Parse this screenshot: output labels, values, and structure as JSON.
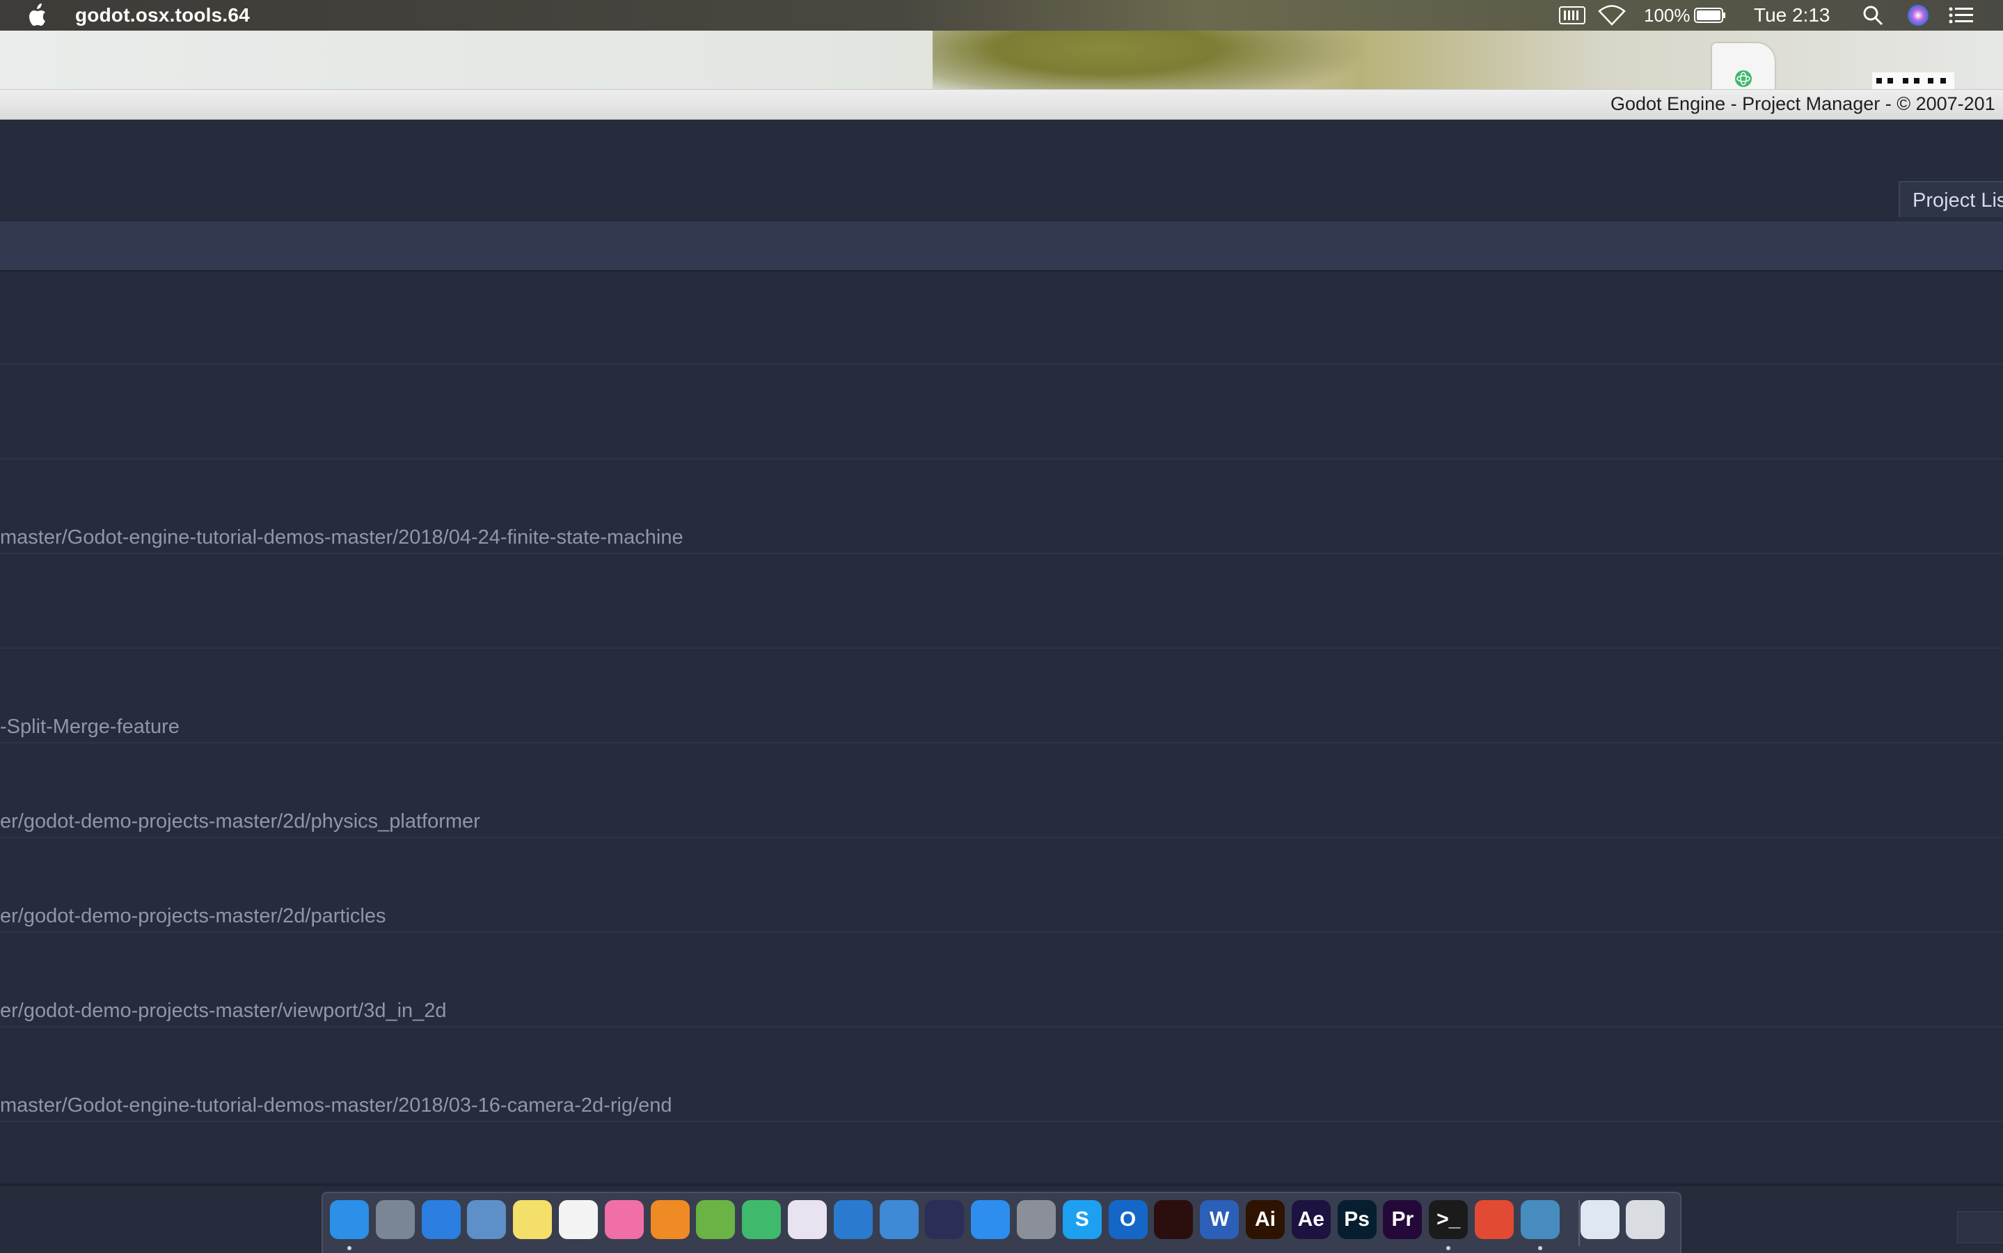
{
  "menubar": {
    "app_name": "godot.osx.tools.64",
    "battery_percent": "100%",
    "clock": "Tue 2:13",
    "icons": [
      "apple-icon",
      "keyboard-input-icon",
      "wifi-icon",
      "battery-icon",
      "spotlight-search-icon",
      "siri-icon",
      "notification-center-icon"
    ]
  },
  "window": {
    "title": "Godot Engine - Project Manager - © 2007-201"
  },
  "tabs": {
    "project_list": "Project Lis"
  },
  "projects": [
    {
      "path": ""
    },
    {
      "path": ""
    },
    {
      "path": "master/Godot-engine-tutorial-demos-master/2018/04-24-finite-state-machine"
    },
    {
      "path": ""
    },
    {
      "path": "-Split-Merge-feature"
    },
    {
      "path": "er/godot-demo-projects-master/2d/physics_platformer"
    },
    {
      "path": "er/godot-demo-projects-master/2d/particles"
    },
    {
      "path": "er/godot-demo-projects-master/viewport/3d_in_2d"
    },
    {
      "path": "master/Godot-engine-tutorial-demos-master/2018/03-16-camera-2d-rig/end"
    }
  ],
  "dock": {
    "items": [
      {
        "name": "finder",
        "label": "",
        "color": "#2c8fe8",
        "running": true
      },
      {
        "name": "launchpad",
        "label": "",
        "color": "#7a8596",
        "running": false
      },
      {
        "name": "safari",
        "label": "",
        "color": "#2a7fe0",
        "running": false
      },
      {
        "name": "preview",
        "label": "",
        "color": "#5d8fc8",
        "running": false
      },
      {
        "name": "notes",
        "label": "",
        "color": "#f3df6a",
        "running": false
      },
      {
        "name": "photos",
        "label": "",
        "color": "#f3f3f3",
        "running": false
      },
      {
        "name": "itunes",
        "label": "",
        "color": "#f06fa6",
        "running": false
      },
      {
        "name": "blender",
        "label": "",
        "color": "#f08a24",
        "running": false
      },
      {
        "name": "android-studio",
        "label": "",
        "color": "#6ab344",
        "running": false
      },
      {
        "name": "atom",
        "label": "",
        "color": "#3fb96b",
        "running": false
      },
      {
        "name": "colorsnapper",
        "label": "",
        "color": "#e9e2f0",
        "running": false
      },
      {
        "name": "visual-studio-code",
        "label": "",
        "color": "#2a7ad0",
        "running": false
      },
      {
        "name": "xcode",
        "label": "",
        "color": "#3e8ad6",
        "running": false
      },
      {
        "name": "eclipse",
        "label": "",
        "color": "#2b2f58",
        "running": false
      },
      {
        "name": "app-store",
        "label": "",
        "color": "#2d8ef0",
        "running": false
      },
      {
        "name": "system-preferences",
        "label": "",
        "color": "#8a8f98",
        "running": false
      },
      {
        "name": "skype",
        "label": "S",
        "color": "#1ea0f0",
        "running": false
      },
      {
        "name": "outlook",
        "label": "O",
        "color": "#1467c7",
        "running": false
      },
      {
        "name": "acrobat",
        "label": "",
        "color": "#2b0e0e",
        "running": false
      },
      {
        "name": "word",
        "label": "W",
        "color": "#2b5fb8",
        "running": false
      },
      {
        "name": "illustrator",
        "label": "Ai",
        "color": "#2e1300",
        "running": false
      },
      {
        "name": "after-effects",
        "label": "Ae",
        "color": "#1e1240",
        "running": false
      },
      {
        "name": "photoshop",
        "label": "Ps",
        "color": "#061e2f",
        "running": false
      },
      {
        "name": "premiere",
        "label": "Pr",
        "color": "#25083a",
        "running": false
      },
      {
        "name": "terminal",
        "label": ">_",
        "color": "#1b1b1b",
        "running": true
      },
      {
        "name": "remote-desktop",
        "label": "",
        "color": "#e24a34",
        "running": false
      },
      {
        "name": "godot",
        "label": "",
        "color": "#478cbf",
        "running": true
      },
      {
        "name": "safari-downloads",
        "label": "",
        "color": "#dfe8f2",
        "running": false
      },
      {
        "name": "trash",
        "label": "",
        "color": "#d9dde2",
        "running": false
      }
    ]
  }
}
